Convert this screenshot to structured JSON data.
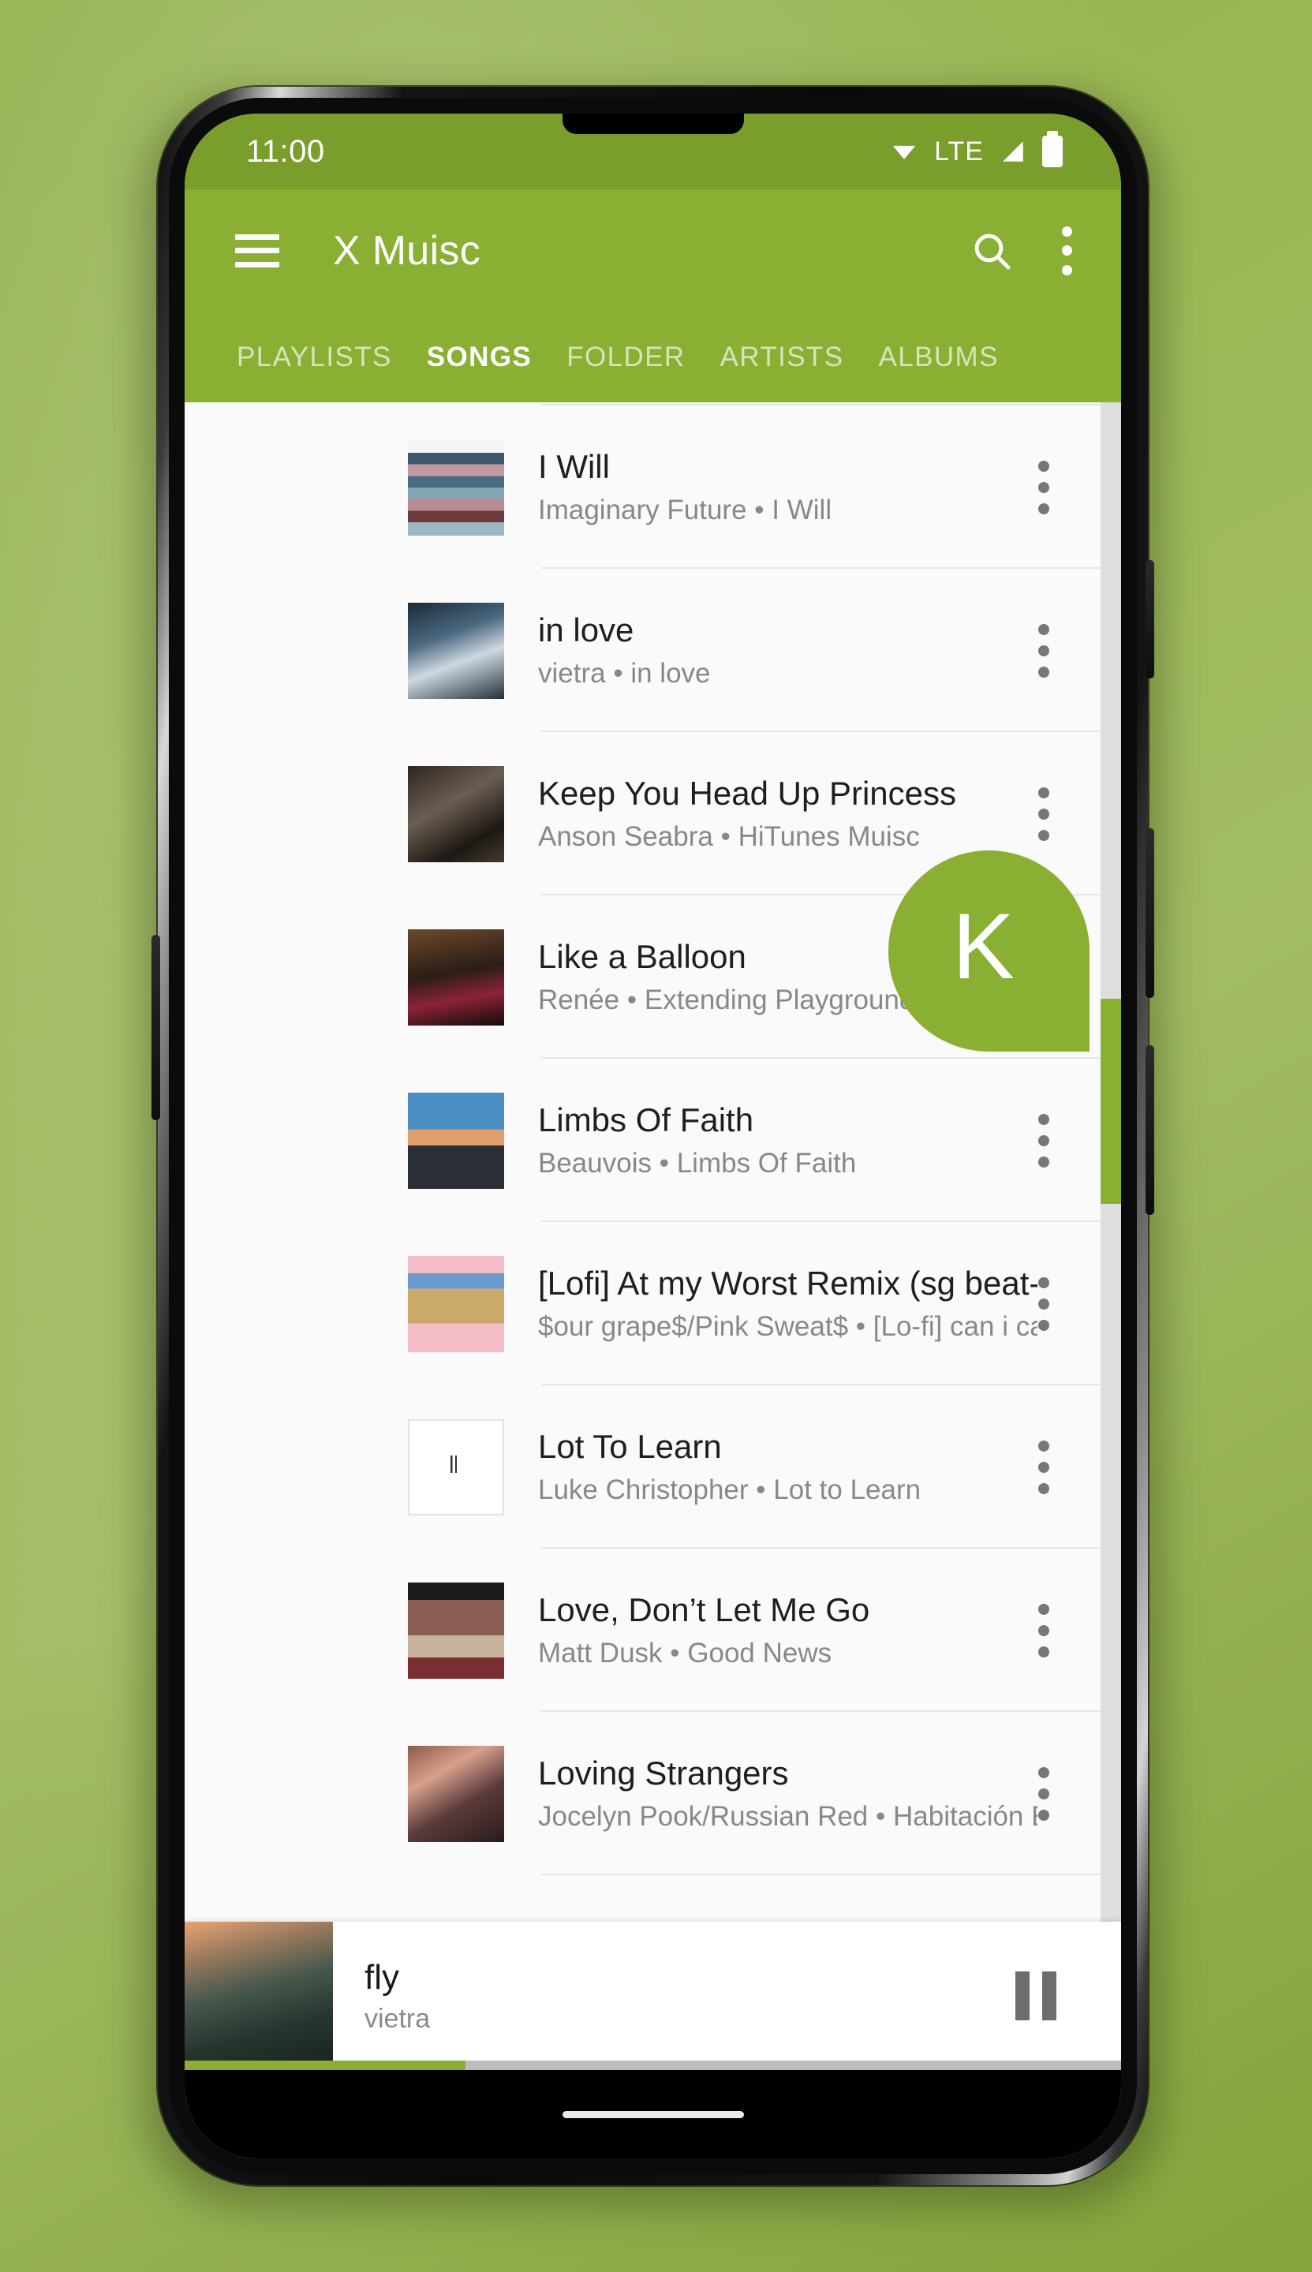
{
  "statusbar": {
    "time": "11:00",
    "network_label": "LTE",
    "icons": [
      "wifi-icon",
      "signal-icon",
      "battery-icon"
    ]
  },
  "appbar": {
    "menu_icon": "hamburger-menu-icon",
    "title": "X Muisc",
    "search_icon": "search-icon",
    "overflow_icon": "more-vertical-icon"
  },
  "tabs": [
    {
      "label": "PLAYLISTS",
      "active": false
    },
    {
      "label": "SONGS",
      "active": true
    },
    {
      "label": "FOLDER",
      "active": false
    },
    {
      "label": "ARTISTS",
      "active": false
    },
    {
      "label": "ALBUMS",
      "active": false
    }
  ],
  "fastscroll": {
    "letter": "K"
  },
  "songs": [
    {
      "title": "I Will",
      "artist": "Imaginary Future",
      "album": "I Will",
      "separator": "•"
    },
    {
      "title": "in love",
      "artist": "vietra",
      "album": "in love",
      "separator": "•"
    },
    {
      "title": "Keep You Head Up Princess",
      "artist": "Anson Seabra",
      "album": "HiTunes Muisc",
      "separator": "•"
    },
    {
      "title": "Like a Balloon",
      "artist": "Renée",
      "album": "Extending Playground",
      "separator": "•"
    },
    {
      "title": "Limbs Of Faith",
      "artist": "Beauvois",
      "album": "Limbs Of Faith",
      "separator": "•"
    },
    {
      "title": "[Lofi] At my Worst Remix (sg beat-ca…",
      "artist": "$our grape$/Pink Sweat$",
      "album": "[Lo-fi] can i ca…",
      "separator": "•"
    },
    {
      "title": "Lot To Learn",
      "artist": "Luke Christopher",
      "album": "Lot to Learn",
      "separator": "•"
    },
    {
      "title": "Love, Don’t Let Me Go",
      "artist": "Matt Dusk",
      "album": "Good News",
      "separator": "•"
    },
    {
      "title": "Loving Strangers",
      "artist": "Jocelyn Pook/Russian Red",
      "album": "Habitación E…",
      "separator": "•"
    }
  ],
  "player": {
    "title": "fly",
    "artist": "vietra",
    "control_icon": "pause-icon",
    "progress_percent": 30
  },
  "colors": {
    "primary": "#8AB033",
    "status_bar": "#7A9E2C",
    "list_background": "#fafafa",
    "title_text": "#1e1e1e",
    "subtitle_text": "#888888"
  }
}
